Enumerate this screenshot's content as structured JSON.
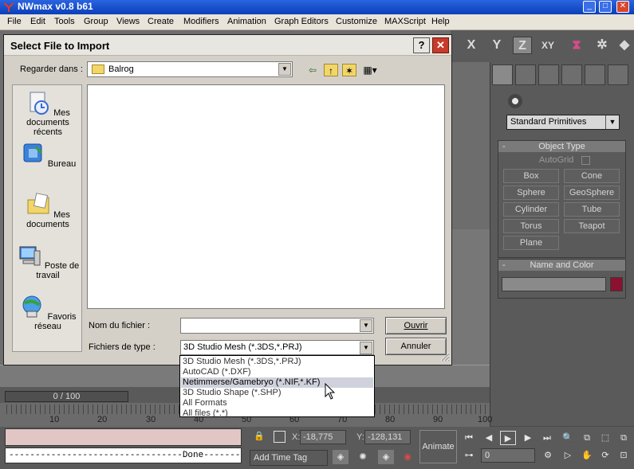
{
  "app": {
    "title": "NWmax v0.8 b61",
    "window_buttons": [
      "_",
      "□",
      "✕"
    ]
  },
  "menu": [
    "File",
    "Edit",
    "Tools",
    "Group",
    "Views",
    "Create",
    "Modifiers",
    "Animation",
    "Graph Editors",
    "Customize",
    "MAXScript",
    "Help"
  ],
  "axis_buttons": [
    "X",
    "Y",
    "Z",
    "XY"
  ],
  "command_panel": {
    "primitive_type": "Standard Primitives",
    "object_type": {
      "title": "Object Type",
      "autogrid_label": "AutoGrid",
      "buttons": [
        "Box",
        "Cone",
        "Sphere",
        "GeoSphere",
        "Cylinder",
        "Tube",
        "Torus",
        "Teapot",
        "Plane"
      ]
    },
    "name_color": {
      "title": "Name and Color",
      "swatch_color": "#8c1030"
    }
  },
  "timeline": {
    "frame_display": "0 / 100",
    "ticks": [
      "10",
      "20",
      "30",
      "40",
      "50",
      "60",
      "70",
      "80",
      "90",
      "100"
    ]
  },
  "status": {
    "done_text": "---------------------------------Done---------",
    "x_label": "X:",
    "x_value": "-18,775",
    "y_label": "Y:",
    "y_value": "-128,131",
    "animate_label": "Animate",
    "add_time_tag": "Add Time Tag",
    "frame_value": "0"
  },
  "dialog": {
    "title": "Select File to Import",
    "help_label": "?",
    "close_label": "✕",
    "look_in_label": "Regarder dans :",
    "look_in_value": "Balrog",
    "places": [
      "Mes documents récents",
      "Bureau",
      "Mes documents",
      "Poste de travail",
      "Favoris réseau"
    ],
    "file_name_label": "Nom du fichier :",
    "file_name_value": "",
    "file_type_label": "Fichiers de type :",
    "file_type_value": "3D Studio Mesh (*.3DS,*.PRJ)",
    "open_button": "Ouvrir",
    "cancel_button": "Annuler",
    "file_type_options": [
      "3D Studio Mesh (*.3DS,*.PRJ)",
      "AutoCAD (*.DXF)",
      "Netimmerse/Gamebryo (*.NIF,*.KF)",
      "3D Studio Shape (*.SHP)",
      "All Formats",
      "All files (*.*)"
    ],
    "highlighted_option_index": 2
  }
}
